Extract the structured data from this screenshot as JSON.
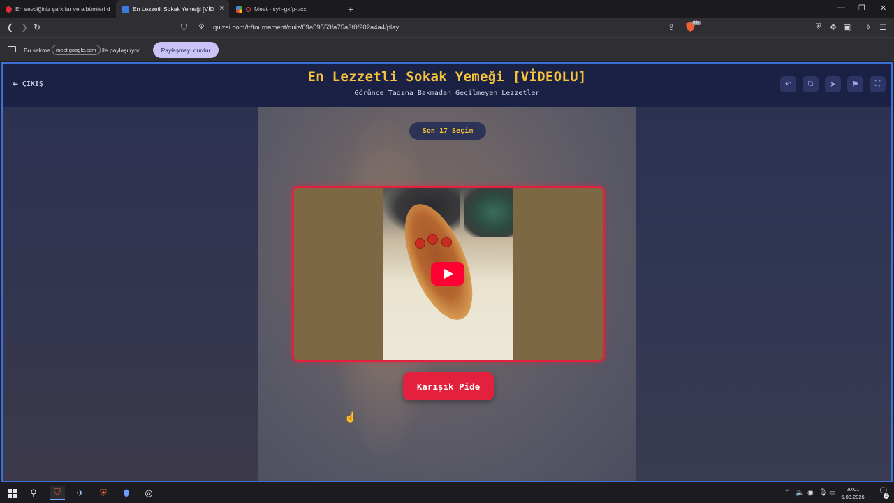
{
  "browser": {
    "tabs": [
      {
        "label": "En sevdiğiniz şarkılar ve albümleri dir",
        "active": false
      },
      {
        "label": "En Lezzetli Sokak Yemeği [VİDEOLU",
        "active": true
      },
      {
        "label": "Meet - syh-gxfp-ucx",
        "active": false
      }
    ],
    "url": "quizei.com/tr/tournament/quiz/69a59553fa75a3f0f202a4a4/play",
    "brave_badge": "99+",
    "share": {
      "prefix": "Bu sekme",
      "domain": "meet.google.com",
      "suffix": "ile paylaşılıyor",
      "stop_label": "Paylaşmayı durdur"
    }
  },
  "quiz": {
    "exit_label": "ÇIKIŞ",
    "title": "En Lezzetli Sokak Yemeği [VİDEOLU]",
    "subtitle": "Görünce Tadına Bakmadan Geçilmeyen Lezzetler",
    "round_label": "Son 17 Seçim",
    "choice_label": "Karışık Pide",
    "accent_color": "#e3213f",
    "title_color": "#f5c33b",
    "header_icons": [
      "undo-icon",
      "share-icon",
      "send-icon",
      "flag-icon",
      "fullscreen-icon"
    ]
  },
  "taskbar": {
    "time": "20:01",
    "date": "5.03.2026",
    "notifications": "2"
  }
}
